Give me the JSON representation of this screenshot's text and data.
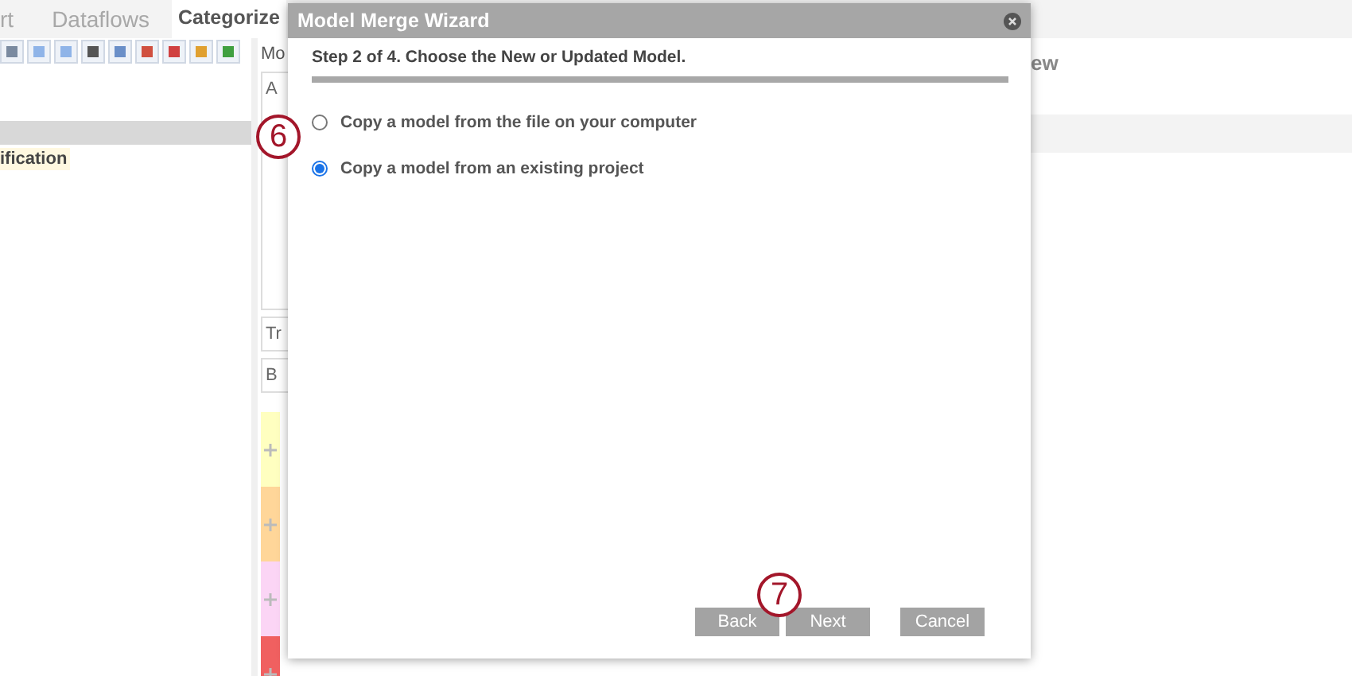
{
  "background": {
    "tabs": [
      {
        "label": "rt",
        "selected": false
      },
      {
        "label": "Dataflows",
        "selected": false
      },
      {
        "label": "Categorize",
        "selected": true
      }
    ],
    "toolbar_label": "Mo",
    "tree_item": "ification",
    "panel_labels": [
      "A",
      "Tr",
      "B"
    ],
    "right_heading": "ew",
    "strips": [
      {
        "color": "#ffffc0"
      },
      {
        "color": "#ffd699"
      },
      {
        "color": "#fbd5f5"
      },
      {
        "color": "#f06060"
      }
    ]
  },
  "wizard": {
    "title": "Model Merge Wizard",
    "step": "Step 2 of 4. Choose the New or Updated Model.",
    "options": [
      {
        "label": "Copy a model from the file on your computer",
        "selected": false
      },
      {
        "label": "Copy a model from an existing project",
        "selected": true
      }
    ],
    "buttons": [
      "Back",
      "Next",
      "Cancel"
    ]
  },
  "callouts": [
    "6",
    "7"
  ]
}
